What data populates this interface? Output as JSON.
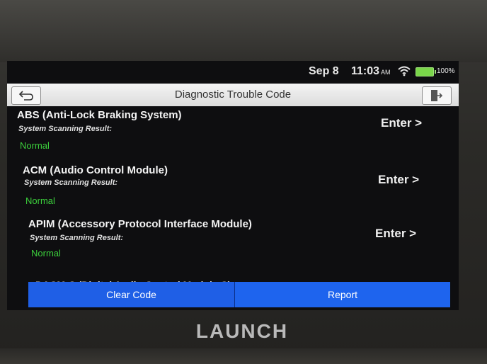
{
  "status_bar": {
    "date": "Sep 8",
    "time": "11:03",
    "ampm": "AM",
    "battery_pct": "100%",
    "icons": [
      "wifi-icon",
      "battery-icon"
    ]
  },
  "header": {
    "title": "Diagnostic Trouble Code",
    "back_icon": "back-arrow-icon",
    "exit_icon": "exit-icon"
  },
  "modules": [
    {
      "title": "ABS (Anti-Lock Braking System)",
      "subtitle": "System Scanning Result:",
      "status": "Normal",
      "enter_label": "Enter >"
    },
    {
      "title": "ACM (Audio Control Module)",
      "subtitle": "System Scanning Result:",
      "status": "Normal",
      "enter_label": "Enter >"
    },
    {
      "title": "APIM (Accessory Protocol Interface Module)",
      "subtitle": "System Scanning Result:",
      "status": "Normal",
      "enter_label": "Enter >"
    },
    {
      "title": "DACM-C (Digital Audio Control Module C)"
    }
  ],
  "actions": {
    "clear_code": "Clear Code",
    "report": "Report"
  },
  "brand": "LAUNCH",
  "colors": {
    "normal_status": "#3ccf3c",
    "action_bar": "#1e5ee8",
    "battery": "#7ad64a"
  }
}
